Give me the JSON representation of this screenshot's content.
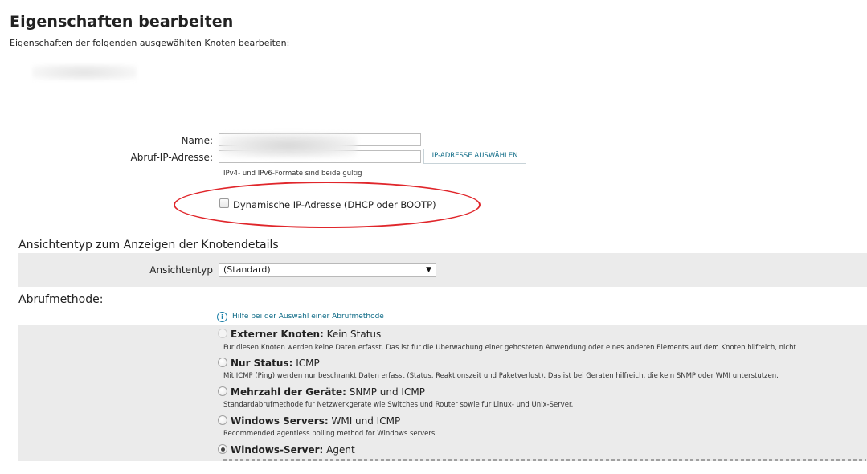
{
  "header": {
    "title": "Eigenschaften bearbeiten",
    "subtitle": "Eigenschaften der folgenden ausgewählten Knoten bearbeiten:"
  },
  "form": {
    "name_label": "Name:",
    "name_value": "",
    "ip_label": "Abruf-IP-Adresse:",
    "ip_value": "",
    "select_ip_button": "IP-ADRESSE AUSWÄHLEN",
    "ip_hint": "IPv4- und IPv6-Formate sind beide gultig",
    "dynamic_ip_label": "Dynamische IP-Adresse (DHCP oder BOOTP)",
    "dynamic_ip_checked": false
  },
  "view_type": {
    "section_title": "Ansichtentyp zum Anzeigen der Knotendetails",
    "label": "Ansichtentyp",
    "selected": "(Standard)"
  },
  "polling": {
    "section_title": "Abrufmethode:",
    "help_link": "Hilfe bei der Auswahl einer Abrufmethode",
    "options": [
      {
        "title_bold": "Externer Knoten:",
        "title_rest": " Kein Status",
        "desc": "Fur diesen Knoten werden keine Daten erfasst. Das ist fur die Uberwachung einer gehosteten Anwendung oder eines anderen Elements auf dem Knoten hilfreich, nicht",
        "checked": false
      },
      {
        "title_bold": "Nur Status:",
        "title_rest": " ICMP",
        "desc": "Mit ICMP (Ping) werden nur beschrankt Daten erfasst (Status, Reaktionszeit und Paketverlust). Das ist bei Geraten hilfreich, die kein SNMP oder WMI unterstutzen.",
        "checked": false
      },
      {
        "title_bold": "Mehrzahl der Geräte:",
        "title_rest": " SNMP und ICMP",
        "desc": "Standardabrufmethode fur Netzwerkgerate wie Switches und Router sowie fur Linux- und Unix-Server.",
        "checked": false
      },
      {
        "title_bold": "Windows Servers:",
        "title_rest": " WMI und ICMP",
        "desc": "Recommended agentless polling method for Windows servers.",
        "checked": false
      },
      {
        "title_bold": "Windows-Server:",
        "title_rest": " Agent",
        "desc": "",
        "checked": true
      }
    ]
  },
  "colors": {
    "accent": "#0d6a86",
    "highlight_ellipse": "#e0262b",
    "row_background": "#ebebeb"
  }
}
